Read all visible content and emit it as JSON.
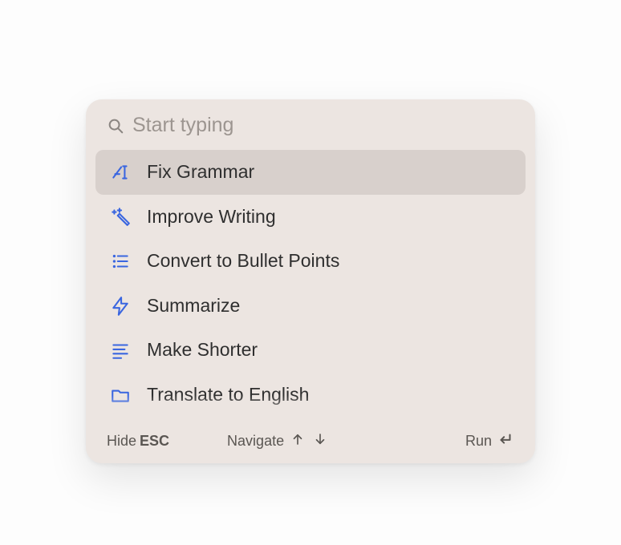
{
  "search": {
    "placeholder": "Start typing",
    "value": ""
  },
  "items": [
    {
      "icon": "text-cursor-icon",
      "label": "Fix Grammar",
      "selected": true
    },
    {
      "icon": "sparkle-wand-icon",
      "label": "Improve Writing",
      "selected": false
    },
    {
      "icon": "bullet-list-icon",
      "label": "Convert to Bullet Points",
      "selected": false
    },
    {
      "icon": "lightning-icon",
      "label": "Summarize",
      "selected": false
    },
    {
      "icon": "text-lines-icon",
      "label": "Make Shorter",
      "selected": false
    },
    {
      "icon": "folder-icon",
      "label": "Translate to English",
      "selected": false
    }
  ],
  "footer": {
    "hide_label": "Hide",
    "hide_key": "ESC",
    "navigate_label": "Navigate",
    "run_label": "Run"
  }
}
